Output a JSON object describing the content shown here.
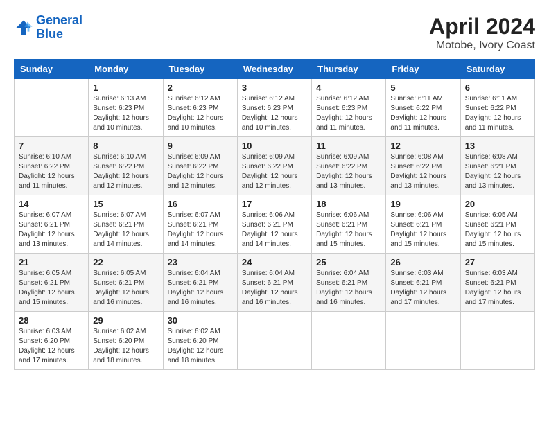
{
  "logo": {
    "line1": "General",
    "line2": "Blue"
  },
  "title": "April 2024",
  "subtitle": "Motobe, Ivory Coast",
  "weekdays": [
    "Sunday",
    "Monday",
    "Tuesday",
    "Wednesday",
    "Thursday",
    "Friday",
    "Saturday"
  ],
  "weeks": [
    [
      {
        "day": "",
        "info": ""
      },
      {
        "day": "1",
        "info": "Sunrise: 6:13 AM\nSunset: 6:23 PM\nDaylight: 12 hours\nand 10 minutes."
      },
      {
        "day": "2",
        "info": "Sunrise: 6:12 AM\nSunset: 6:23 PM\nDaylight: 12 hours\nand 10 minutes."
      },
      {
        "day": "3",
        "info": "Sunrise: 6:12 AM\nSunset: 6:23 PM\nDaylight: 12 hours\nand 10 minutes."
      },
      {
        "day": "4",
        "info": "Sunrise: 6:12 AM\nSunset: 6:23 PM\nDaylight: 12 hours\nand 11 minutes."
      },
      {
        "day": "5",
        "info": "Sunrise: 6:11 AM\nSunset: 6:22 PM\nDaylight: 12 hours\nand 11 minutes."
      },
      {
        "day": "6",
        "info": "Sunrise: 6:11 AM\nSunset: 6:22 PM\nDaylight: 12 hours\nand 11 minutes."
      }
    ],
    [
      {
        "day": "7",
        "info": "Sunrise: 6:10 AM\nSunset: 6:22 PM\nDaylight: 12 hours\nand 11 minutes."
      },
      {
        "day": "8",
        "info": "Sunrise: 6:10 AM\nSunset: 6:22 PM\nDaylight: 12 hours\nand 12 minutes."
      },
      {
        "day": "9",
        "info": "Sunrise: 6:09 AM\nSunset: 6:22 PM\nDaylight: 12 hours\nand 12 minutes."
      },
      {
        "day": "10",
        "info": "Sunrise: 6:09 AM\nSunset: 6:22 PM\nDaylight: 12 hours\nand 12 minutes."
      },
      {
        "day": "11",
        "info": "Sunrise: 6:09 AM\nSunset: 6:22 PM\nDaylight: 12 hours\nand 13 minutes."
      },
      {
        "day": "12",
        "info": "Sunrise: 6:08 AM\nSunset: 6:22 PM\nDaylight: 12 hours\nand 13 minutes."
      },
      {
        "day": "13",
        "info": "Sunrise: 6:08 AM\nSunset: 6:21 PM\nDaylight: 12 hours\nand 13 minutes."
      }
    ],
    [
      {
        "day": "14",
        "info": "Sunrise: 6:07 AM\nSunset: 6:21 PM\nDaylight: 12 hours\nand 13 minutes."
      },
      {
        "day": "15",
        "info": "Sunrise: 6:07 AM\nSunset: 6:21 PM\nDaylight: 12 hours\nand 14 minutes."
      },
      {
        "day": "16",
        "info": "Sunrise: 6:07 AM\nSunset: 6:21 PM\nDaylight: 12 hours\nand 14 minutes."
      },
      {
        "day": "17",
        "info": "Sunrise: 6:06 AM\nSunset: 6:21 PM\nDaylight: 12 hours\nand 14 minutes."
      },
      {
        "day": "18",
        "info": "Sunrise: 6:06 AM\nSunset: 6:21 PM\nDaylight: 12 hours\nand 15 minutes."
      },
      {
        "day": "19",
        "info": "Sunrise: 6:06 AM\nSunset: 6:21 PM\nDaylight: 12 hours\nand 15 minutes."
      },
      {
        "day": "20",
        "info": "Sunrise: 6:05 AM\nSunset: 6:21 PM\nDaylight: 12 hours\nand 15 minutes."
      }
    ],
    [
      {
        "day": "21",
        "info": "Sunrise: 6:05 AM\nSunset: 6:21 PM\nDaylight: 12 hours\nand 15 minutes."
      },
      {
        "day": "22",
        "info": "Sunrise: 6:05 AM\nSunset: 6:21 PM\nDaylight: 12 hours\nand 16 minutes."
      },
      {
        "day": "23",
        "info": "Sunrise: 6:04 AM\nSunset: 6:21 PM\nDaylight: 12 hours\nand 16 minutes."
      },
      {
        "day": "24",
        "info": "Sunrise: 6:04 AM\nSunset: 6:21 PM\nDaylight: 12 hours\nand 16 minutes."
      },
      {
        "day": "25",
        "info": "Sunrise: 6:04 AM\nSunset: 6:21 PM\nDaylight: 12 hours\nand 16 minutes."
      },
      {
        "day": "26",
        "info": "Sunrise: 6:03 AM\nSunset: 6:21 PM\nDaylight: 12 hours\nand 17 minutes."
      },
      {
        "day": "27",
        "info": "Sunrise: 6:03 AM\nSunset: 6:21 PM\nDaylight: 12 hours\nand 17 minutes."
      }
    ],
    [
      {
        "day": "28",
        "info": "Sunrise: 6:03 AM\nSunset: 6:20 PM\nDaylight: 12 hours\nand 17 minutes."
      },
      {
        "day": "29",
        "info": "Sunrise: 6:02 AM\nSunset: 6:20 PM\nDaylight: 12 hours\nand 18 minutes."
      },
      {
        "day": "30",
        "info": "Sunrise: 6:02 AM\nSunset: 6:20 PM\nDaylight: 12 hours\nand 18 minutes."
      },
      {
        "day": "",
        "info": ""
      },
      {
        "day": "",
        "info": ""
      },
      {
        "day": "",
        "info": ""
      },
      {
        "day": "",
        "info": ""
      }
    ]
  ]
}
